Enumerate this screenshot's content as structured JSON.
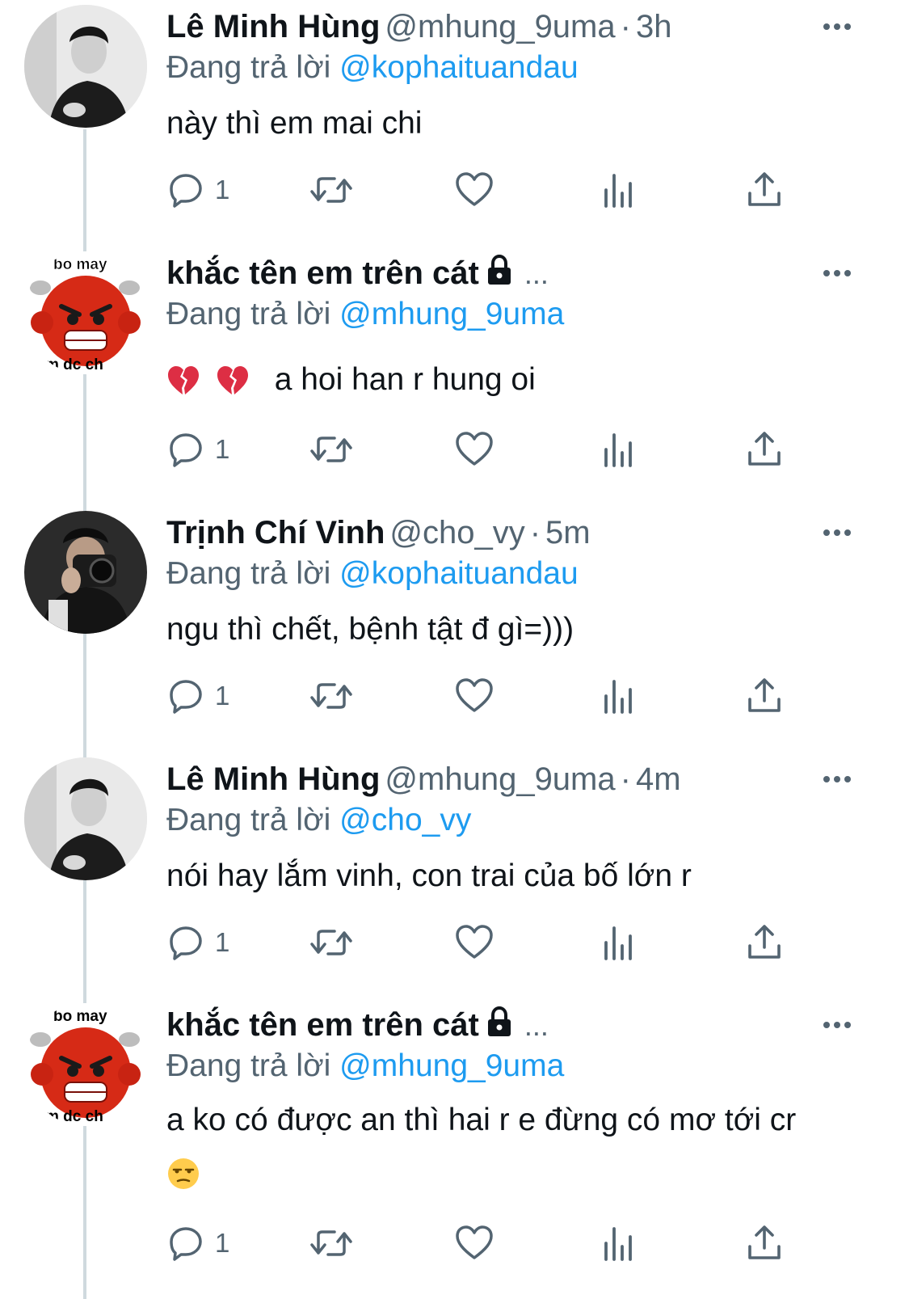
{
  "tweets": [
    {
      "avatar": "portrait-photo-man-black-white",
      "name": "Lê Minh Hùng",
      "handle": "@mhung_9uma",
      "time": "3h",
      "reply_label": "Đang trả lời",
      "reply_to": "@kophaituandau",
      "text": "này thì em mai chi",
      "reply_count": "1"
    },
    {
      "avatar": "angry-red-emoji-sticker",
      "avatar_text_top": "bo may",
      "avatar_text_bottom": "m dc ch",
      "name": "khắc tên em trên cát",
      "lock_icon": "lock-icon",
      "truncation": "...",
      "reply_label": "Đang trả lời",
      "reply_to": "@mhung_9uma",
      "text": "a hoi han r hung oi",
      "reply_count": "1"
    },
    {
      "avatar": "photo-man-with-camera",
      "name": "Trịnh Chí Vinh",
      "handle": "@cho_vy",
      "time": "5m",
      "reply_label": "Đang trả lời",
      "reply_to": "@kophaituandau",
      "text": "ngu thì chết, bệnh tật đ gì=)))",
      "reply_count": "1"
    },
    {
      "avatar": "portrait-photo-man-black-white",
      "name": "Lê Minh Hùng",
      "handle": "@mhung_9uma",
      "time": "4m",
      "reply_label": "Đang trả lời",
      "reply_to": "@cho_vy",
      "text": "nói hay lắm vinh, con trai của bố lớn r",
      "reply_count": "1"
    },
    {
      "avatar": "angry-red-emoji-sticker",
      "avatar_text_top": "bo may",
      "avatar_text_bottom": "m dc ch",
      "name": "khắc tên em trên cát",
      "lock_icon": "lock-icon",
      "truncation": "...",
      "reply_label": "Đang trả lời",
      "reply_to": "@mhung_9uma",
      "text": "a ko có được an thì hai r e đừng có mơ tới cr",
      "reply_count": "1"
    }
  ],
  "colors": {
    "primary_text": "#0f1419",
    "secondary_text": "#536471",
    "link": "#1d9bf0",
    "thread_line": "#cfd9de"
  }
}
